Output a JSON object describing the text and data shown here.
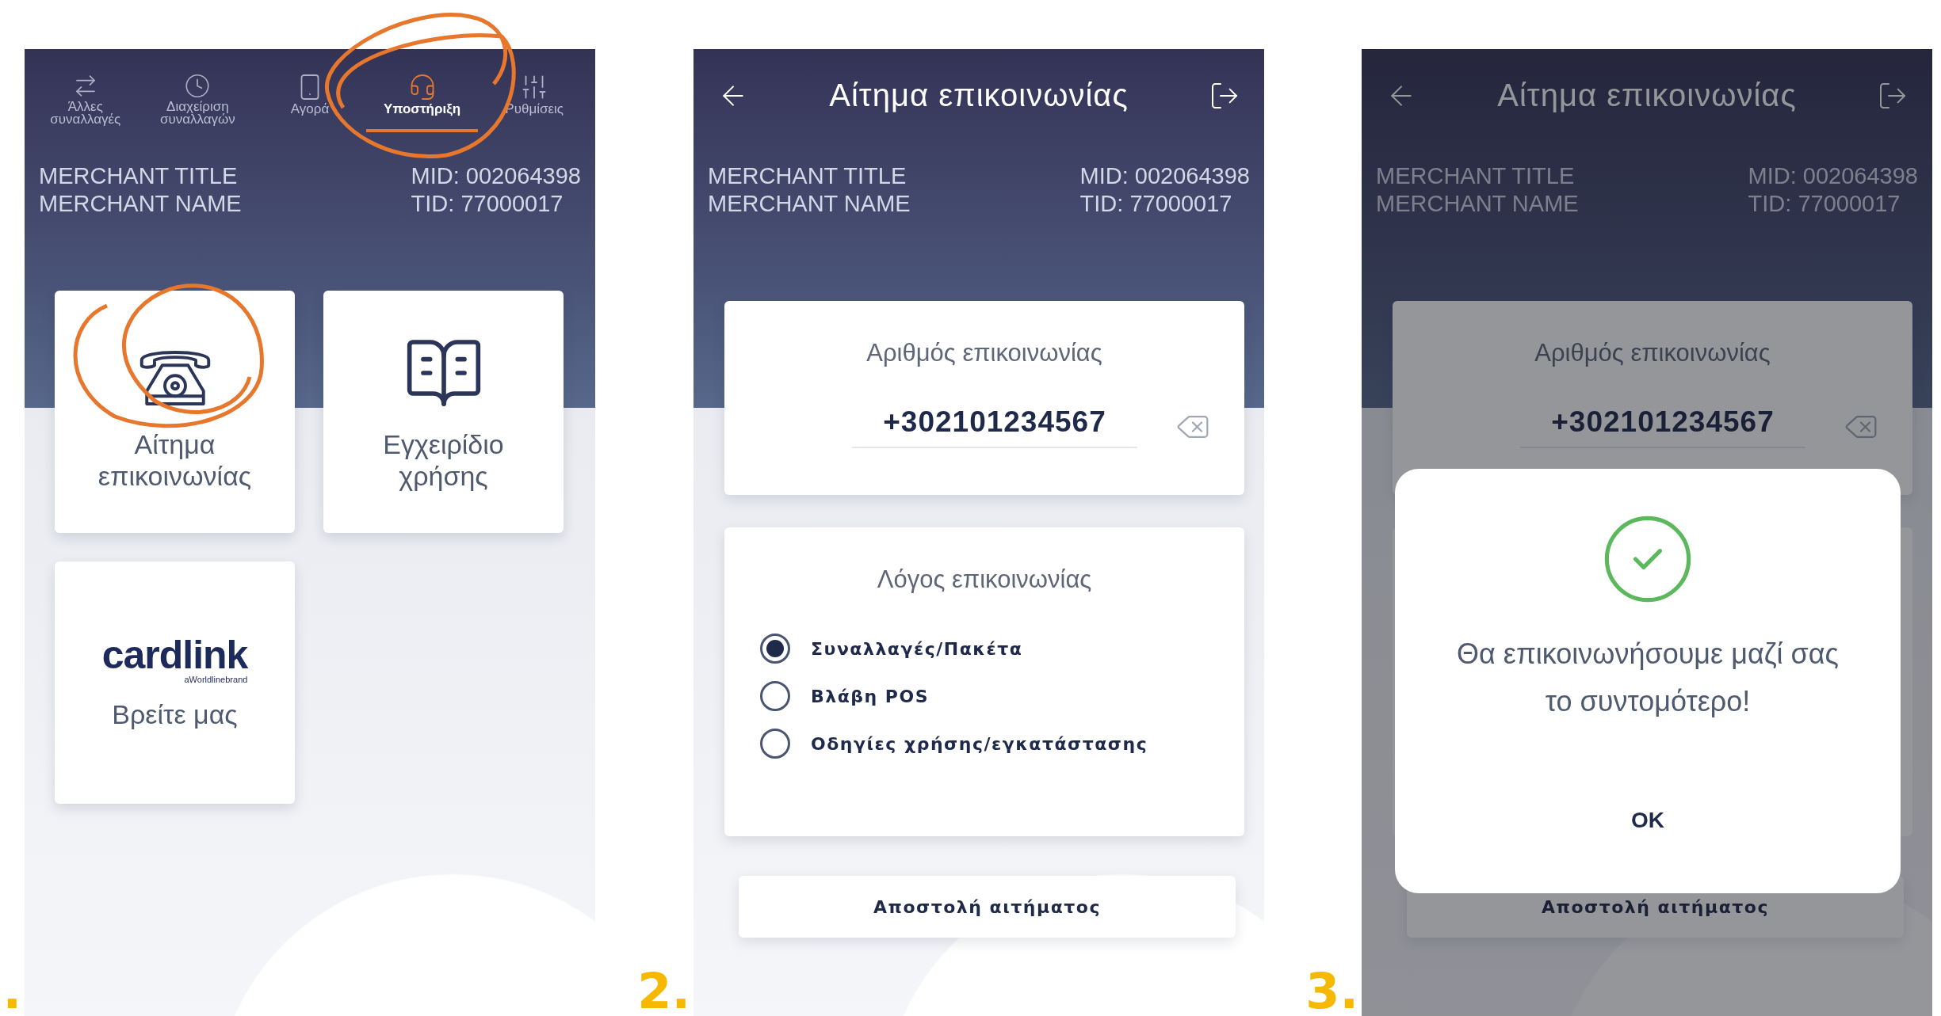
{
  "screens": [
    {
      "kind": "menu",
      "step_label": ".",
      "tabs": [
        {
          "label": "Άλλες\nσυναλλαγές",
          "selected": false
        },
        {
          "label": "Διαχείριση\nσυναλλαγών",
          "selected": false
        },
        {
          "label": "Αγορά",
          "selected": false
        },
        {
          "label": "Υποστήριξη",
          "selected": true
        },
        {
          "label": "Ρυθμίσεις",
          "selected": false
        }
      ],
      "merchant": {
        "title": "MERCHANT TITLE",
        "name": "MERCHANT NAME",
        "mid": "MID: 002064398",
        "tid": "TID: 77000017"
      },
      "tiles": [
        {
          "kind": "phone",
          "label": "Αίτημα επικοινωνίας"
        },
        {
          "kind": "manual",
          "label": "Εγχειρίδιο χρήσης"
        },
        {
          "kind": "logo",
          "logo": "cardlink",
          "logo_sub": "aWorldlinebrand",
          "label": "Βρείτε μας"
        }
      ]
    },
    {
      "kind": "form",
      "step_label": "2.",
      "title": "Αίτημα επικοινωνίας",
      "merchant": {
        "title": "MERCHANT TITLE",
        "name": "MERCHANT NAME",
        "mid": "MID: 002064398",
        "tid": "TID: 77000017"
      },
      "phone": {
        "label": "Αριθμός επικοινωνίας",
        "value": "+302101234567"
      },
      "reason": {
        "label": "Λόγος επικοινωνίας",
        "options": [
          {
            "label": "Συναλλαγές/Πακέτα",
            "selected": true
          },
          {
            "label": "Βλάβη POS",
            "selected": false
          },
          {
            "label": "Οδηγίες χρήσης/εγκατάστασης",
            "selected": false
          }
        ]
      },
      "submit": "Αποστολή αιτήματος"
    },
    {
      "kind": "dialog",
      "step_label": "3.",
      "title": "Αίτημα επικοινωνίας",
      "merchant": {
        "title": "MERCHANT TITLE",
        "name": "MERCHANT NAME",
        "mid": "MID: 002064398",
        "tid": "TID: 77000017"
      },
      "phone": {
        "label": "Αριθμός επικοινωνίας",
        "value": "+302101234567"
      },
      "submit": "Αποστολή αιτήματος",
      "dialog": {
        "message": "Θα επικοινωνήσουμε μαζί σας το συντομότερο!",
        "button": "OK"
      }
    }
  ]
}
